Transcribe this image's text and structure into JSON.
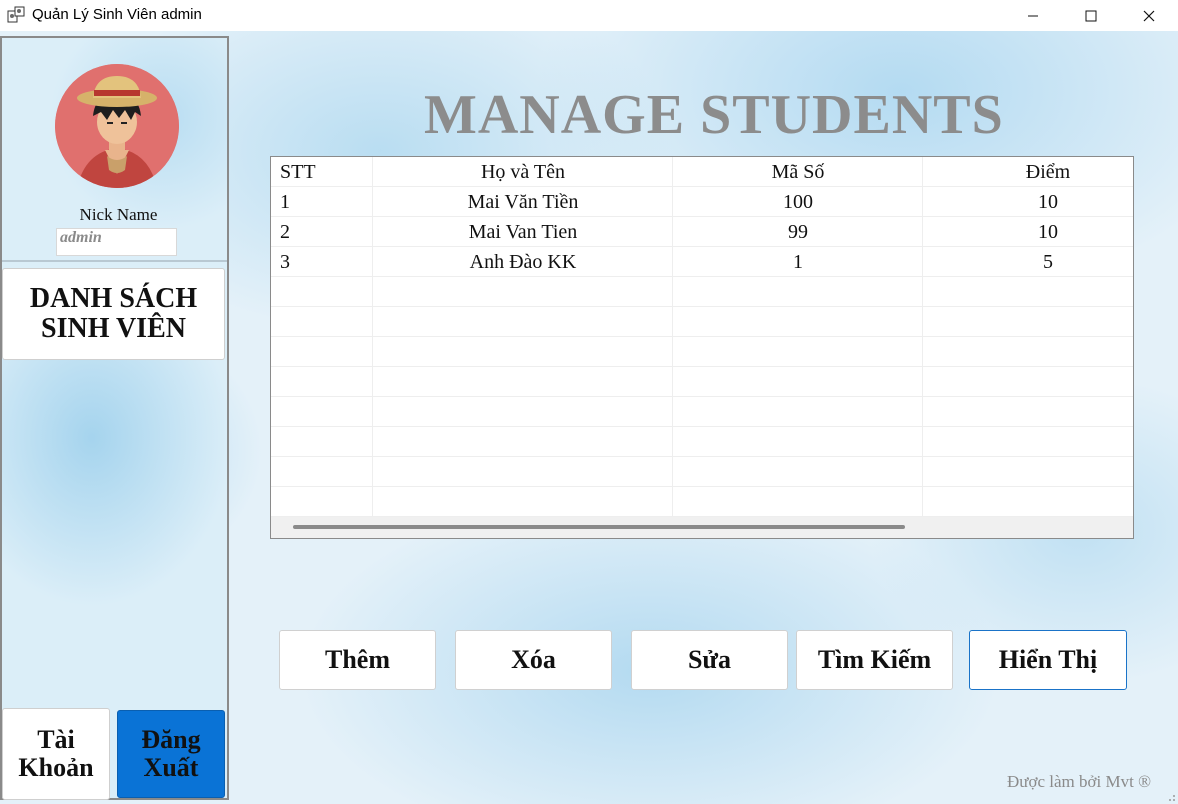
{
  "window": {
    "title": "Quản Lý Sinh Viên admin",
    "icon": "app-icon",
    "controls": [
      "minimize-icon",
      "maximize-icon",
      "close-icon"
    ]
  },
  "sidebar": {
    "nick_label": "Nick Name",
    "nick_value": "admin",
    "menu_button": "DANH SÁCH SINH VIÊN",
    "account_button": "Tài Khoản",
    "logout_button": "Đăng Xuất"
  },
  "main": {
    "title": "MANAGE STUDENTS",
    "table": {
      "columns": [
        "STT",
        "Họ và Tên",
        "Mã Số",
        "Điểm"
      ],
      "rows": [
        [
          "1",
          "Mai Văn Tiền",
          "100",
          "10"
        ],
        [
          "2",
          "Mai Van Tien",
          "99",
          "10"
        ],
        [
          "3",
          "Anh Đào KK",
          "1",
          "5"
        ]
      ]
    },
    "actions": {
      "add": "Thêm",
      "delete": "Xóa",
      "edit": "Sửa",
      "search": "Tìm Kiếm",
      "show": "Hiển Thị"
    }
  },
  "footer": "Được làm bởi Mvt ®",
  "colors": {
    "logout_bg": "#0a73d6",
    "title_gray": "#8c8c8c",
    "focus_border": "#1a73c8"
  }
}
